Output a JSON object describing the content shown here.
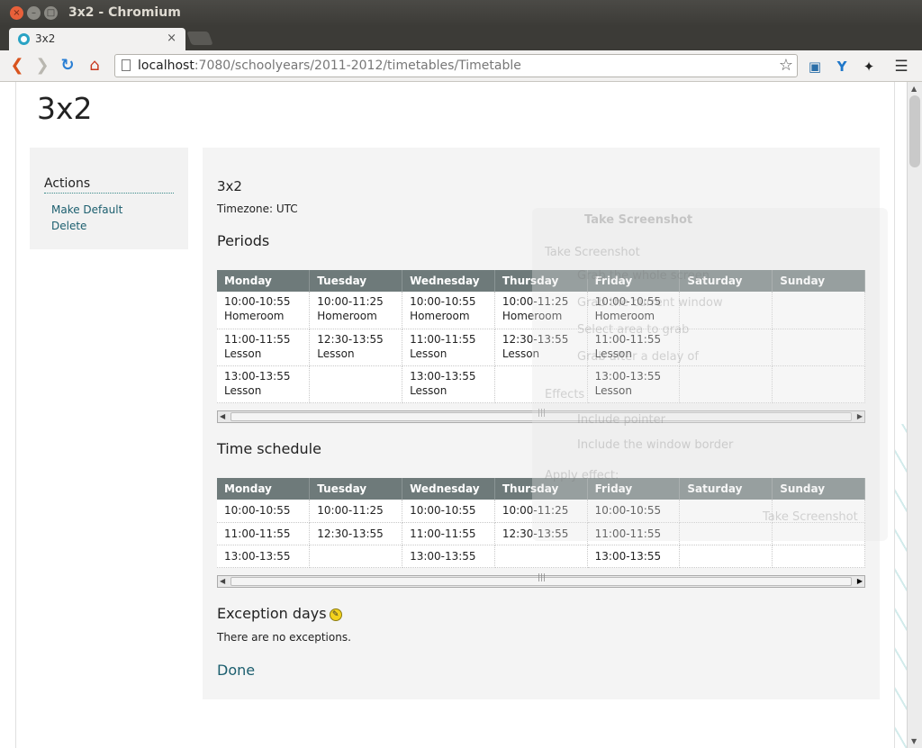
{
  "window": {
    "title": "3x2 - Chromium"
  },
  "tab": {
    "title": "3x2",
    "close": "×"
  },
  "toolbar": {
    "url_host": "localhost",
    "url_path": ":7080/schoolyears/2011-2012/timetables/Timetable"
  },
  "page": {
    "title": "3x2",
    "sidebar": {
      "heading": "Actions",
      "links": [
        "Make Default",
        "Delete"
      ]
    },
    "timetable_name": "3x2",
    "timezone": "Timezone: UTC",
    "periods_heading": "Periods",
    "schedule_heading": "Time schedule",
    "exceptions_heading": "Exception days",
    "no_exceptions": "There are no exceptions.",
    "done": "Done",
    "days": [
      "Monday",
      "Tuesday",
      "Wednesday",
      "Thursday",
      "Friday",
      "Saturday",
      "Sunday"
    ],
    "periods": [
      [
        {
          "time": "10:00-10:55",
          "name": "Homeroom"
        },
        {
          "time": "10:00-11:25",
          "name": "Homeroom"
        },
        {
          "time": "10:00-10:55",
          "name": "Homeroom"
        },
        {
          "time": "10:00-11:25",
          "name": "Homeroom"
        },
        {
          "time": "10:00-10:55",
          "name": "Homeroom"
        },
        {
          "time": "",
          "name": ""
        },
        {
          "time": "",
          "name": ""
        }
      ],
      [
        {
          "time": "11:00-11:55",
          "name": "Lesson"
        },
        {
          "time": "12:30-13:55",
          "name": "Lesson"
        },
        {
          "time": "11:00-11:55",
          "name": "Lesson"
        },
        {
          "time": "12:30-13:55",
          "name": "Lesson"
        },
        {
          "time": "11:00-11:55",
          "name": "Lesson"
        },
        {
          "time": "",
          "name": ""
        },
        {
          "time": "",
          "name": ""
        }
      ],
      [
        {
          "time": "13:00-13:55",
          "name": "Lesson"
        },
        {
          "time": "",
          "name": ""
        },
        {
          "time": "13:00-13:55",
          "name": "Lesson"
        },
        {
          "time": "",
          "name": ""
        },
        {
          "time": "13:00-13:55",
          "name": "Lesson"
        },
        {
          "time": "",
          "name": ""
        },
        {
          "time": "",
          "name": ""
        }
      ]
    ],
    "schedule": [
      [
        "10:00-10:55",
        "10:00-11:25",
        "10:00-10:55",
        "10:00-11:25",
        "10:00-10:55",
        "",
        ""
      ],
      [
        "11:00-11:55",
        "12:30-13:55",
        "11:00-11:55",
        "12:30-13:55",
        "11:00-11:55",
        "",
        ""
      ],
      [
        "13:00-13:55",
        "",
        "13:00-13:55",
        "",
        "13:00-13:55",
        "",
        ""
      ]
    ]
  },
  "ghost_dialog": {
    "title": "Take Screenshot",
    "lines": [
      "Take Screenshot",
      "Grab the whole screen",
      "Grab the current window",
      "Select area to grab",
      "Grab after a delay of",
      "Effects",
      "Include pointer",
      "Include the window border",
      "Apply effect:",
      "Take Screenshot"
    ]
  }
}
